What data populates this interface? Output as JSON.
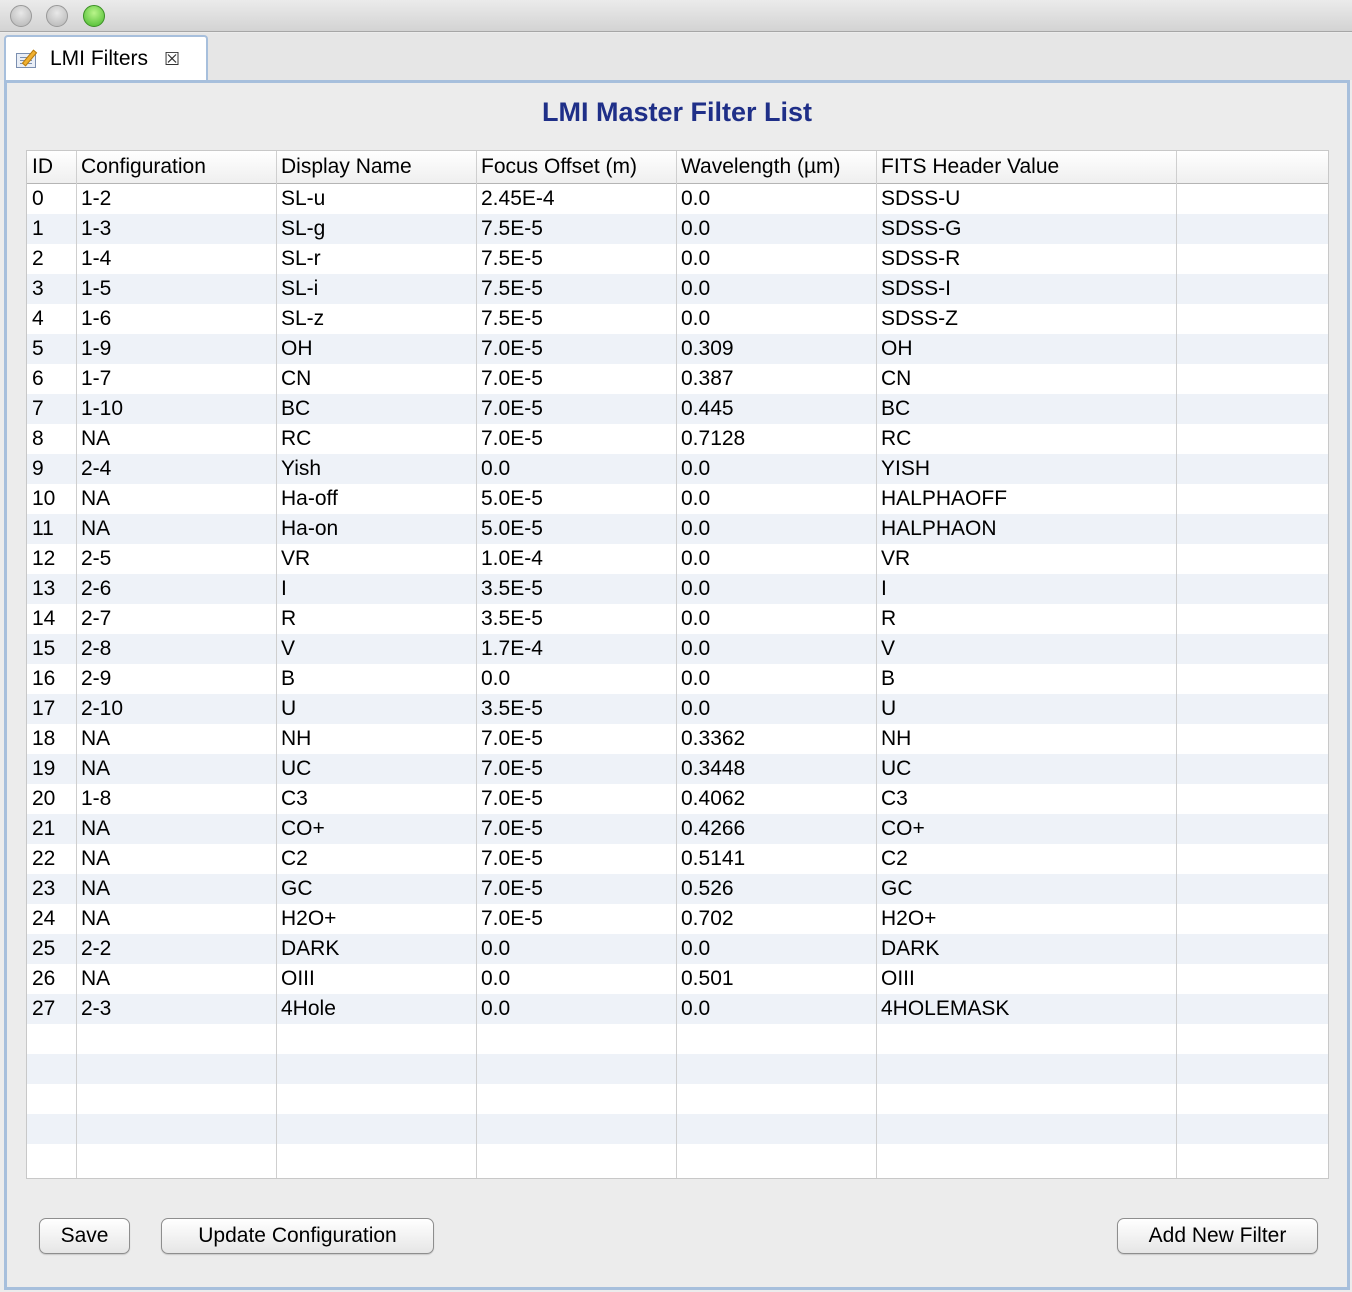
{
  "tab": {
    "label": "LMI Filters"
  },
  "title": "LMI Master Filter List",
  "table": {
    "columns": [
      "ID",
      "Configuration",
      "Display Name",
      "Focus Offset (m)",
      "Wavelength (µm)",
      "FITS Header Value"
    ],
    "rows": [
      [
        "0",
        "1-2",
        "SL-u",
        "2.45E-4",
        "0.0",
        "SDSS-U"
      ],
      [
        "1",
        "1-3",
        "SL-g",
        "7.5E-5",
        "0.0",
        "SDSS-G"
      ],
      [
        "2",
        "1-4",
        "SL-r",
        "7.5E-5",
        "0.0",
        "SDSS-R"
      ],
      [
        "3",
        "1-5",
        "SL-i",
        "7.5E-5",
        "0.0",
        "SDSS-I"
      ],
      [
        "4",
        "1-6",
        "SL-z",
        "7.5E-5",
        "0.0",
        "SDSS-Z"
      ],
      [
        "5",
        "1-9",
        "OH",
        "7.0E-5",
        "0.309",
        "OH"
      ],
      [
        "6",
        "1-7",
        "CN",
        "7.0E-5",
        "0.387",
        "CN"
      ],
      [
        "7",
        "1-10",
        "BC",
        "7.0E-5",
        "0.445",
        "BC"
      ],
      [
        "8",
        "NA",
        "RC",
        "7.0E-5",
        "0.7128",
        "RC"
      ],
      [
        "9",
        "2-4",
        "Yish",
        "0.0",
        "0.0",
        "YISH"
      ],
      [
        "10",
        "NA",
        "Ha-off",
        "5.0E-5",
        "0.0",
        "HALPHAOFF"
      ],
      [
        "11",
        "NA",
        "Ha-on",
        "5.0E-5",
        "0.0",
        "HALPHAON"
      ],
      [
        "12",
        "2-5",
        "VR",
        "1.0E-4",
        "0.0",
        "VR"
      ],
      [
        "13",
        "2-6",
        "I",
        "3.5E-5",
        "0.0",
        "I"
      ],
      [
        "14",
        "2-7",
        "R",
        "3.5E-5",
        "0.0",
        "R"
      ],
      [
        "15",
        "2-8",
        "V",
        "1.7E-4",
        "0.0",
        "V"
      ],
      [
        "16",
        "2-9",
        "B",
        "0.0",
        "0.0",
        "B"
      ],
      [
        "17",
        "2-10",
        "U",
        "3.5E-5",
        "0.0",
        "U"
      ],
      [
        "18",
        "NA",
        "NH",
        "7.0E-5",
        "0.3362",
        "NH"
      ],
      [
        "19",
        "NA",
        "UC",
        "7.0E-5",
        "0.3448",
        "UC"
      ],
      [
        "20",
        "1-8",
        "C3",
        "7.0E-5",
        "0.4062",
        "C3"
      ],
      [
        "21",
        "NA",
        "CO+",
        "7.0E-5",
        "0.4266",
        "CO+"
      ],
      [
        "22",
        "NA",
        "C2",
        "7.0E-5",
        "0.5141",
        "C2"
      ],
      [
        "23",
        "NA",
        "GC",
        "7.0E-5",
        "0.526",
        "GC"
      ],
      [
        "24",
        "NA",
        "H2O+",
        "7.0E-5",
        "0.702",
        "H2O+"
      ],
      [
        "25",
        "2-2",
        "DARK",
        "0.0",
        "0.0",
        "DARK"
      ],
      [
        "26",
        "NA",
        "OIII",
        "0.0",
        "0.501",
        "OIII"
      ],
      [
        "27",
        "2-3",
        "4Hole",
        "0.0",
        "0.0",
        "4HOLEMASK"
      ]
    ]
  },
  "buttons": {
    "save": "Save",
    "update_configuration": "Update Configuration",
    "add_new_filter": "Add New Filter"
  },
  "icons": {
    "tab_icon": "edit-document-icon",
    "tab_close": "close-icon",
    "window_close": "close-window-icon",
    "window_minimize": "minimize-window-icon",
    "window_zoom": "zoom-window-icon"
  }
}
